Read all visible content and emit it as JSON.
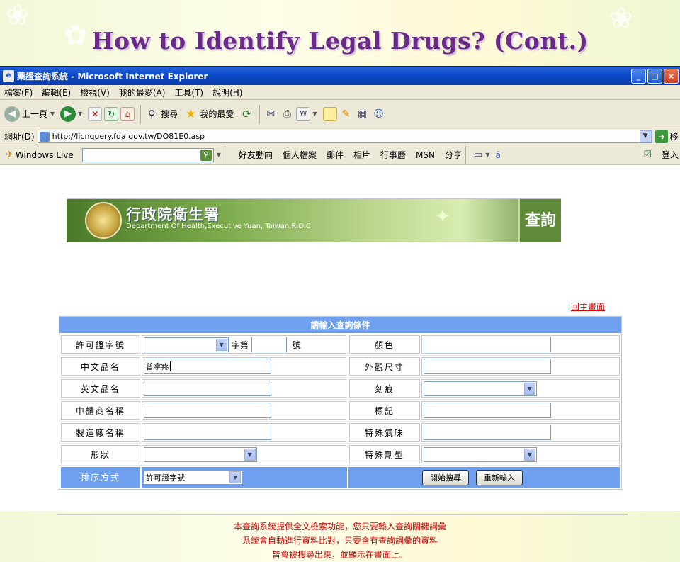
{
  "slide": {
    "title": "How to Identify Legal Drugs? (Cont.)"
  },
  "window": {
    "title": "藥證查詢系統 - Microsoft Internet Explorer",
    "controls": {
      "minimize": "_",
      "maximize": "□",
      "close": "×"
    }
  },
  "menu": [
    "檔案(F)",
    "編輯(E)",
    "檢視(V)",
    "我的最愛(A)",
    "工具(T)",
    "說明(H)"
  ],
  "toolbar": {
    "back": "上一頁",
    "search": "搜尋",
    "favorites": "我的最愛"
  },
  "address": {
    "label": "網址(D)",
    "url": "http://licnquery.fda.gov.tw/DO81E0.asp",
    "go": "移"
  },
  "live": {
    "brand": "Windows Live",
    "links": [
      "好友動向",
      "個人檔案",
      "郵件",
      "相片",
      "行事曆",
      "MSN",
      "分享"
    ],
    "signin": "登入"
  },
  "banner": {
    "title_zh": "行政院衛生署",
    "title_en": "Department Of Health,Executive Yuan, Taiwan,R.O.C",
    "query": "查詢"
  },
  "back_link": "回主畫面",
  "form": {
    "header": "請輸入查詢條件",
    "license_label": "許可證字號",
    "license_zi": "字第",
    "license_hao": "號",
    "color_label": "顏色",
    "cname_label": "中文品名",
    "cname_value": "普拿疼",
    "appearance_label": "外觀尺寸",
    "ename_label": "英文品名",
    "score_label": "刻痕",
    "applicant_label": "申請商名稱",
    "mark_label": "標記",
    "manufacturer_label": "製造廠名稱",
    "odor_label": "特殊氣味",
    "shape_label": "形狀",
    "dosage_label": "特殊劑型",
    "sort_label": "排序方式",
    "sort_value": "許可證字號",
    "start_button": "開始搜尋",
    "reset_button": "重新輸入"
  },
  "notice": [
    "本查詢系統提供全文檢索功能，您只要輸入查詢關鍵詞彙",
    "系統會自動進行資料比對，只要含有查詢詞彙的資料",
    "皆會被搜尋出來，並顯示在畫面上。"
  ],
  "colors": {
    "accent": "#6fa0ef",
    "title": "#6a2a8a",
    "notice": "#cc0000"
  }
}
